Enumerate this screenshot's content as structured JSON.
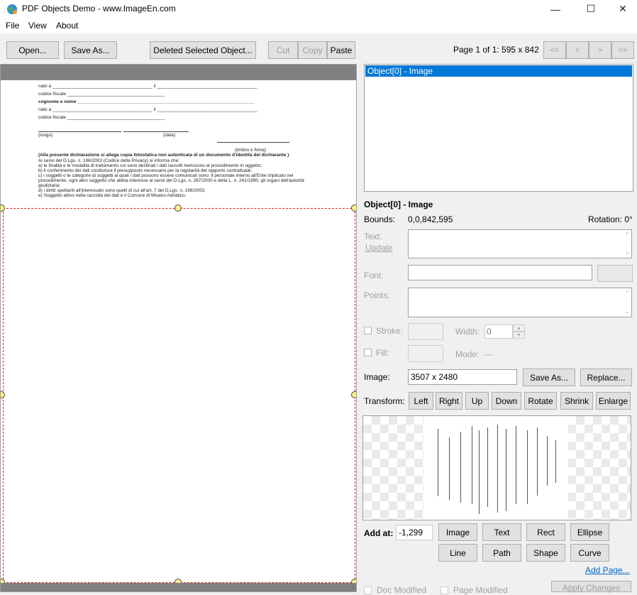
{
  "window": {
    "title": "PDF Objects Demo - www.ImageEn.com",
    "minimize": "—",
    "maximize": "☐",
    "close": "✕"
  },
  "menu": [
    "File",
    "View",
    "About"
  ],
  "toolbar": {
    "open": "Open...",
    "save_as": "Save As...",
    "delete_selected": "Deleted Selected Object...",
    "cut": "Cut",
    "copy": "Copy",
    "paste": "Paste",
    "page_info": "Page 1 of 1: 595 x 842",
    "first": "<<",
    "prev": "<",
    "next": ">",
    "last": ">>"
  },
  "document": {
    "lines": [
      "nato a _______________________________________ il _______________________________________",
      "codice fiscale ______________________________________",
      "cognome e nome _____________________________________________________________________",
      "nato a _______________________________________ il _______________________________________",
      "codice fiscale ______________________________________"
    ],
    "luogo": "(luogo)",
    "data": "(data)",
    "timbro": "(timbro e firma)",
    "notice": "(Alla presente dichiarazione si allega copia fotostatica non autenticata di un documento d'identità del dichiarante )",
    "privacy": [
      "Ai sensi del D.Lgs. n. 196/2003 (Codice della Privacy) si informa che:",
      "a)      le finalità e le modalità di trattamento cui sono destinati i dati raccolti ineriscono al procedimento in oggetto;",
      "b)      il conferimento dei dati costituisce il presupposto necessario per la regolarità del rapporto contrattuale;",
      "c)      i soggetti o le categorie di soggetti ai quali i dati possono essere comunicati sono: il personale interno all'Ente implicato nel",
      "procedimento, ogni altro soggetto che abbia interesse ai sensi del D.Lgs. n. 267/2000 e della L. n. 241/1990, gli organi dell'autorità",
      "giudiziaria;",
      "d)      i diritti spettanti all'interessato sono quelli di cui all'art. 7 del D.Lgs. n. 196/2003;",
      "e)      Soggetto attivo nella raccolta dei dati è il Comune di Misano Adriatico."
    ]
  },
  "object_list": [
    "Object[0] - Image"
  ],
  "props": {
    "header": "Object[0] - Image",
    "bounds_label": "Bounds:",
    "bounds_value": "0,0,842,595",
    "rotation": "Rotation: 0°",
    "text_label": "Text:",
    "update_label": "Update",
    "font_label": "Font:",
    "points_label": "Points:",
    "stroke_label": "Stroke:",
    "width_label": "Width:",
    "width_value": "0",
    "fill_label": "Fill:",
    "mode_label": "Mode:",
    "mode_value": "---",
    "image_label": "Image:",
    "image_value": "3507 x 2480",
    "save_as": "Save As...",
    "replace": "Replace...",
    "transform_label": "Transform:",
    "transform": [
      "Left",
      "Right",
      "Up",
      "Down",
      "Rotate",
      "Shrink",
      "Enlarge"
    ]
  },
  "add": {
    "label": "Add at:",
    "value": "-1,299",
    "buttons": [
      "Image",
      "Text",
      "Rect",
      "Ellipse",
      "Line",
      "Path",
      "Shape",
      "Curve"
    ],
    "add_page": "Add Page..."
  },
  "status": {
    "doc_modified": "Doc Modified",
    "page_modified": "Page Modified",
    "apply": "Apply Changes"
  }
}
